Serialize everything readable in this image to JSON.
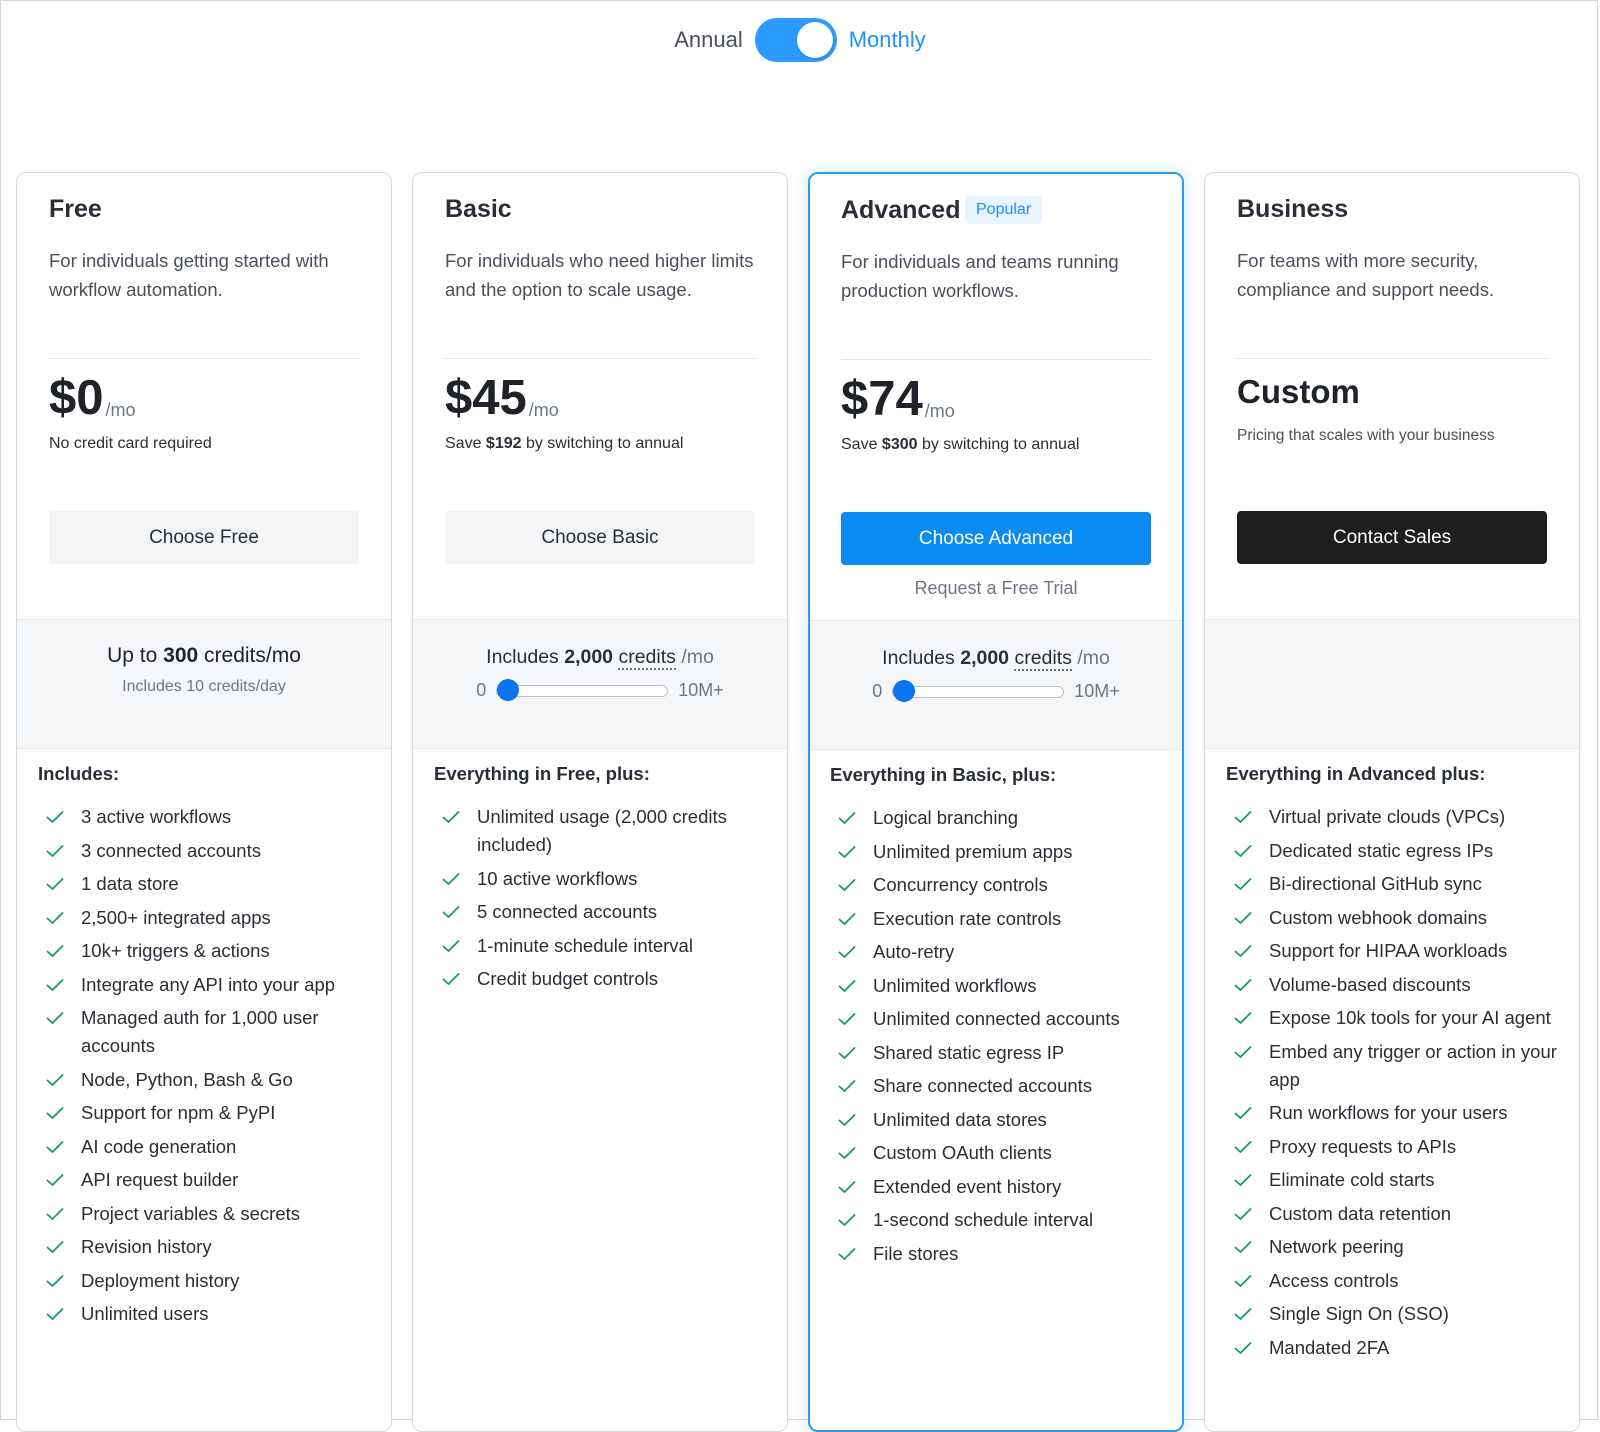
{
  "billing_toggle": {
    "annual_label": "Annual",
    "monthly_label": "Monthly",
    "selected": "Monthly"
  },
  "plans": [
    {
      "name": "Free",
      "description": "For individuals getting started with workflow automation.",
      "price": "$0",
      "price_unit": "/mo",
      "price_note": "No credit card required",
      "cta_label": "Choose Free",
      "credits_prefix": "Up to ",
      "credits_amount": "300",
      "credits_suffix": " credits/mo",
      "credits_sub": "Includes 10 credits/day",
      "features_title": "Includes:",
      "features": [
        "3 active workflows",
        "3 connected accounts",
        "1 data store",
        "2,500+ integrated apps",
        "10k+ triggers & actions",
        "Integrate any API into your app",
        "Managed auth for 1,000 user accounts",
        "Node, Python, Bash & Go",
        "Support for npm & PyPI",
        "AI code generation",
        "API request builder",
        "Project variables & secrets",
        "Revision history",
        "Deployment history",
        "Unlimited users"
      ]
    },
    {
      "name": "Basic",
      "description": "For individuals who need higher limits and the option to scale usage.",
      "price": "$45",
      "price_unit": "/mo",
      "save_prefix": "Save ",
      "save_amount": "$192",
      "save_suffix": " by switching to annual",
      "cta_label": "Choose Basic",
      "credits_prefix": "Includes ",
      "credits_amount": "2,000",
      "credits_word": "credits",
      "credits_unit": "/mo",
      "slider_min": "0",
      "slider_max": "10M+",
      "slider_fraction": 0.0,
      "features_title": "Everything in Free, plus:",
      "features": [
        "Unlimited usage (2,000 credits included)",
        "10 active workflows",
        "5 connected accounts",
        "1-minute schedule interval",
        "Credit budget controls"
      ]
    },
    {
      "name": "Advanced",
      "badge": "Popular",
      "description": "For individuals and teams running production workflows.",
      "price": "$74",
      "price_unit": "/mo",
      "save_prefix": "Save ",
      "save_amount": "$300",
      "save_suffix": " by switching to annual",
      "cta_label": "Choose Advanced",
      "trial_label": "Request a Free Trial",
      "credits_prefix": "Includes ",
      "credits_amount": "2,000",
      "credits_word": "credits",
      "credits_unit": "/mo",
      "slider_min": "0",
      "slider_max": "10M+",
      "slider_fraction": 0.0,
      "features_title": "Everything in Basic, plus:",
      "features": [
        "Logical branching",
        "Unlimited premium apps",
        "Concurrency controls",
        "Execution rate controls",
        "Auto-retry",
        "Unlimited workflows",
        "Unlimited connected accounts",
        "Shared static egress IP",
        "Share connected accounts",
        "Unlimited data stores",
        "Custom OAuth clients",
        "Extended event history",
        "1-second schedule interval",
        "File stores"
      ]
    },
    {
      "name": "Business",
      "description": "For teams with more security, compliance and support needs.",
      "price": "Custom",
      "price_note": "Pricing that scales with your business",
      "cta_label": "Contact Sales",
      "features_title": "Everything in Advanced plus:",
      "features": [
        "Virtual private clouds (VPCs)",
        "Dedicated static egress IPs",
        "Bi-directional GitHub sync",
        "Custom webhook domains",
        "Support for HIPAA workloads",
        "Volume-based discounts",
        "Expose 10k tools for your AI agent",
        "Embed any trigger or action in your app",
        "Run workflows for your users",
        "Proxy requests to APIs",
        "Eliminate cold starts",
        "Custom data retention",
        "Network peering",
        "Access controls",
        "Single Sign On (SSO)",
        "Mandated 2FA"
      ]
    }
  ],
  "colors": {
    "accent": "#0b8cf5",
    "toggle": "#2b9bff",
    "check": "#1a9a5c",
    "dark_button": "#1e1e1e"
  }
}
